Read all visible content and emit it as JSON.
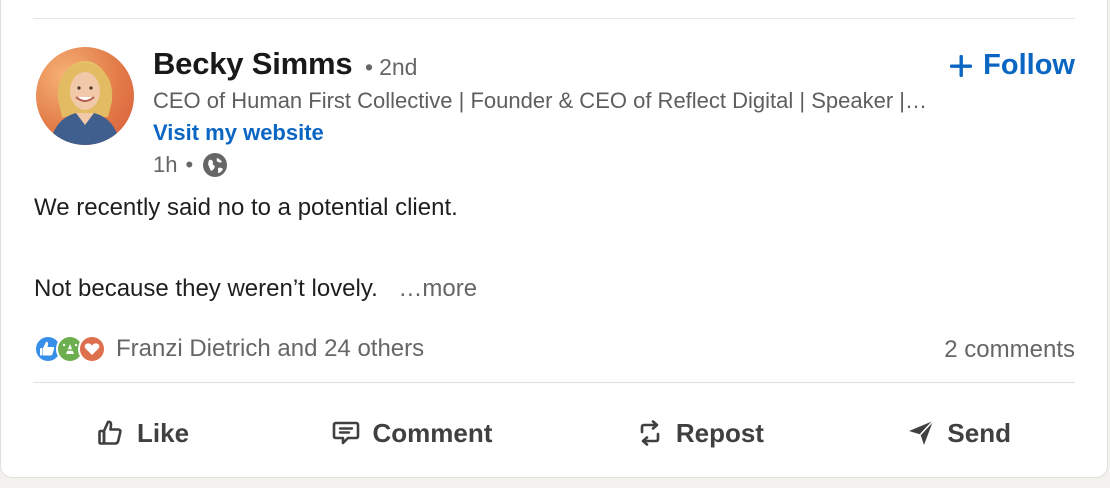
{
  "post": {
    "author": {
      "name": "Becky Simms",
      "degree": "2nd",
      "degree_separator": "•",
      "headline": "CEO of Human First Collective | Founder & CEO of Reflect Digital | Speaker | Author",
      "website_label": "Visit my website",
      "time": "1h",
      "time_separator": "•",
      "visibility_icon": "globe-icon"
    },
    "follow_label": "Follow",
    "text_line1": "We recently said no to a potential client.",
    "text_line2": "Not because they weren’t lovely.",
    "more_label": "…more",
    "reactions": {
      "icons": [
        "like-reaction-icon",
        "celebrate-reaction-icon",
        "love-reaction-icon"
      ],
      "summary": "Franzi Dietrich and 24 others"
    },
    "comments_label": "2 comments",
    "actions": {
      "like": "Like",
      "comment": "Comment",
      "repost": "Repost",
      "send": "Send"
    }
  },
  "colors": {
    "link": "#0a66c2",
    "muted": "#666666",
    "text": "#1f1f1f",
    "like_reaction": "#378fe9",
    "celebrate_reaction": "#6dae4f",
    "love_reaction": "#df704d"
  }
}
